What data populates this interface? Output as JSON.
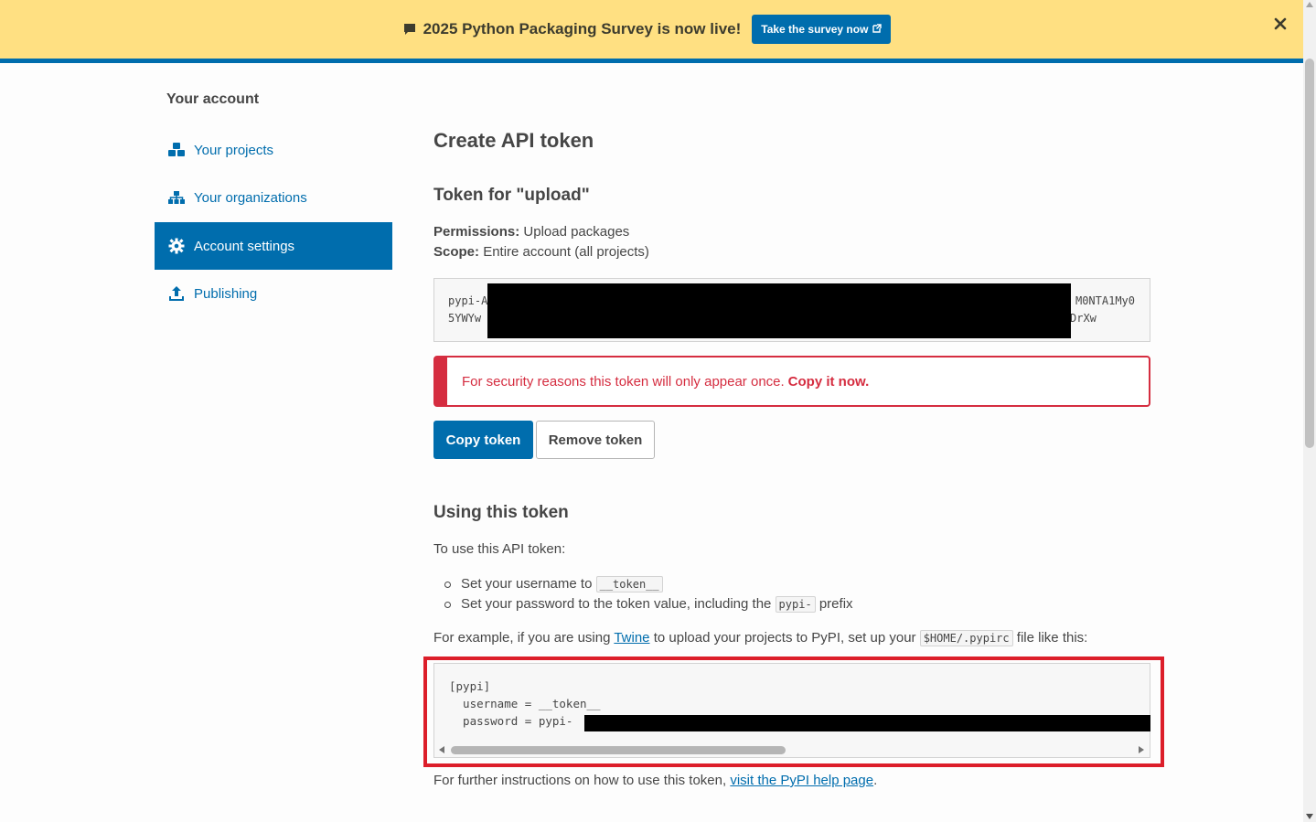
{
  "banner": {
    "text": "2025 Python Packaging Survey is now live!",
    "button_label": "Take the survey now",
    "close_icon": "close-icon",
    "colors": {
      "background": "#ffe082",
      "button": "#006dad"
    }
  },
  "sidebar": {
    "title": "Your account",
    "items": [
      {
        "label": "Your projects",
        "icon": "cubes-icon",
        "active": false
      },
      {
        "label": "Your organizations",
        "icon": "sitemap-icon",
        "active": false
      },
      {
        "label": "Account settings",
        "icon": "gear-icon",
        "active": true
      },
      {
        "label": "Publishing",
        "icon": "upload-icon",
        "active": false
      }
    ]
  },
  "main": {
    "title": "Create API token",
    "token_heading": "Token for \"upload\"",
    "permissions_label": "Permissions:",
    "permissions_value": "Upload packages",
    "scope_label": "Scope:",
    "scope_value": "Entire account (all projects)",
    "token": {
      "line1_start": "pypi-A",
      "line1_end": "M0NTA1My0",
      "line2_start": "5YWYw",
      "line2_end": "DrXw"
    },
    "alert": {
      "text": "For security reasons this token will only appear once.",
      "emphasis": "Copy it now."
    },
    "buttons": {
      "copy": "Copy token",
      "remove": "Remove token"
    },
    "using": {
      "heading": "Using this token",
      "intro": "To use this API token:",
      "bullet1_text": "Set your username to",
      "bullet1_code": "__token__",
      "bullet2_text": "Set your password to the token value, including the",
      "bullet2_code": "pypi-",
      "bullet2_suffix": "prefix",
      "example_prefix": "For example, if you are using",
      "example_link": "Twine",
      "example_mid": "to upload your projects to PyPI, set up your",
      "example_code": "$HOME/.pypirc",
      "example_suffix": "file like this:",
      "code_lines": [
        "[pypi]",
        "  username = __token__",
        "  password = pypi-"
      ],
      "footer_prefix": "For further instructions on how to use this token,",
      "footer_link": "visit the PyPI help page",
      "footer_suffix": "."
    }
  }
}
